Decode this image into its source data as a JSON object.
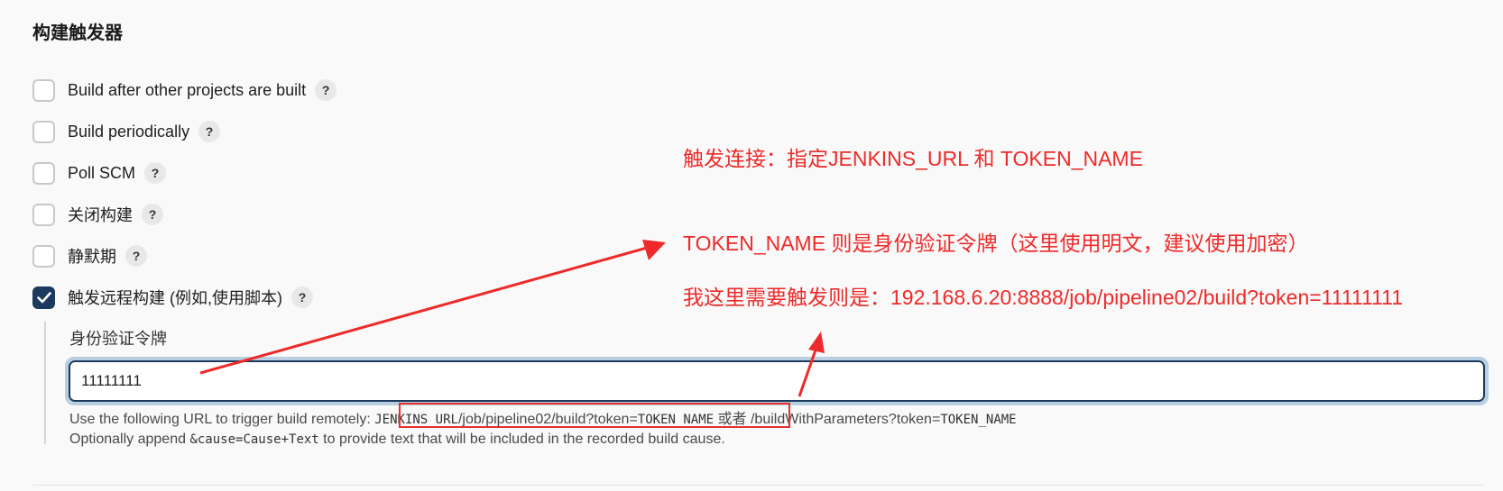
{
  "section": {
    "title": "构建触发器"
  },
  "options": [
    {
      "label": "Build after other projects are built",
      "checked": false
    },
    {
      "label": "Build periodically",
      "checked": false
    },
    {
      "label": "Poll SCM",
      "checked": false
    },
    {
      "label": "关闭构建",
      "checked": false
    },
    {
      "label": "静默期",
      "checked": false
    },
    {
      "label": "触发远程构建 (例如,使用脚本)",
      "checked": true
    }
  ],
  "help_glyph": "?",
  "token": {
    "label": "身份验证令牌",
    "value": "11111111"
  },
  "description": {
    "line1_prefix": "Use the following URL to trigger build remotely: ",
    "line1_code1": "JENKINS_URL",
    "line1_path": "/job/pipeline02/build?token=",
    "line1_code2": "TOKEN_NAME",
    "line1_or": " 或者 /buildWithParameters?token=",
    "line1_code3": "TOKEN_NAME",
    "line2_prefix": "Optionally append ",
    "line2_code": "&cause=Cause+Text",
    "line2_suffix": " to provide text that will be included in the recorded build cause."
  },
  "annotations": {
    "note1": "触发连接：指定JENKINS_URL 和 TOKEN_NAME",
    "note2": "TOKEN_NAME 则是身份验证令牌（这里使用明文，建议使用加密）",
    "note3": "我这里需要触发则是：192.168.6.20:8888/job/pipeline02/build?token=11111111"
  },
  "colors": {
    "accent": "#1c3a5e",
    "annotation_red": "#ee2a2a",
    "background": "#f9f9f9"
  },
  "icons": {
    "checkmark": "check-icon",
    "help": "help-icon",
    "arrow": "arrow-icon"
  }
}
